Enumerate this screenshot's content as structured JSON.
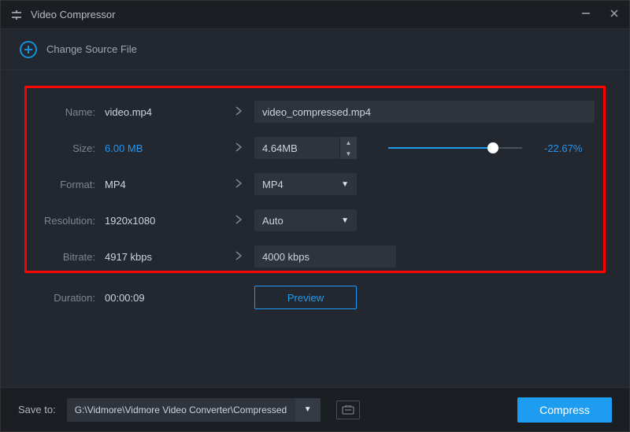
{
  "title": "Video Compressor",
  "change_source": "Change Source File",
  "rows": {
    "name": {
      "label": "Name:",
      "src": "video.mp4",
      "out": "video_compressed.mp4"
    },
    "size": {
      "label": "Size:",
      "src": "6.00 MB",
      "out": "4.64MB",
      "pct": "-22.67%"
    },
    "format": {
      "label": "Format:",
      "src": "MP4",
      "out": "MP4"
    },
    "resolution": {
      "label": "Resolution:",
      "src": "1920x1080",
      "out": "Auto"
    },
    "bitrate": {
      "label": "Bitrate:",
      "src": "4917 kbps",
      "out": "4000 kbps"
    },
    "duration": {
      "label": "Duration:",
      "src": "00:00:09"
    }
  },
  "preview": "Preview",
  "footer": {
    "save_to": "Save to:",
    "path": "G:\\Vidmore\\Vidmore Video Converter\\Compressed",
    "compress": "Compress"
  }
}
